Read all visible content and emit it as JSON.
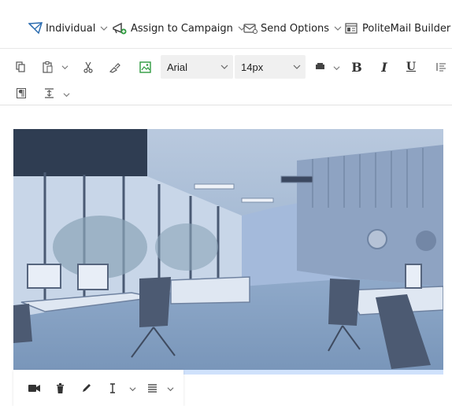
{
  "topbar": {
    "individual_label": "Individual",
    "assign_label": "Assign to Campaign",
    "send_options_label": "Send Options",
    "builder_label": "PoliteMail Builder"
  },
  "format_toolbar": {
    "font_family": "Arial",
    "font_size": "14px",
    "bold_label": "B",
    "italic_label": "I",
    "underline_label": "U"
  },
  "image": {
    "icons": [
      "video-icon",
      "trash-icon",
      "pencil-icon",
      "line-height-icon",
      "align-icon"
    ]
  },
  "colors": {
    "accent_blue": "#2b6cb0",
    "image_tint": "#9db8d9",
    "icon_gray": "#555555"
  }
}
